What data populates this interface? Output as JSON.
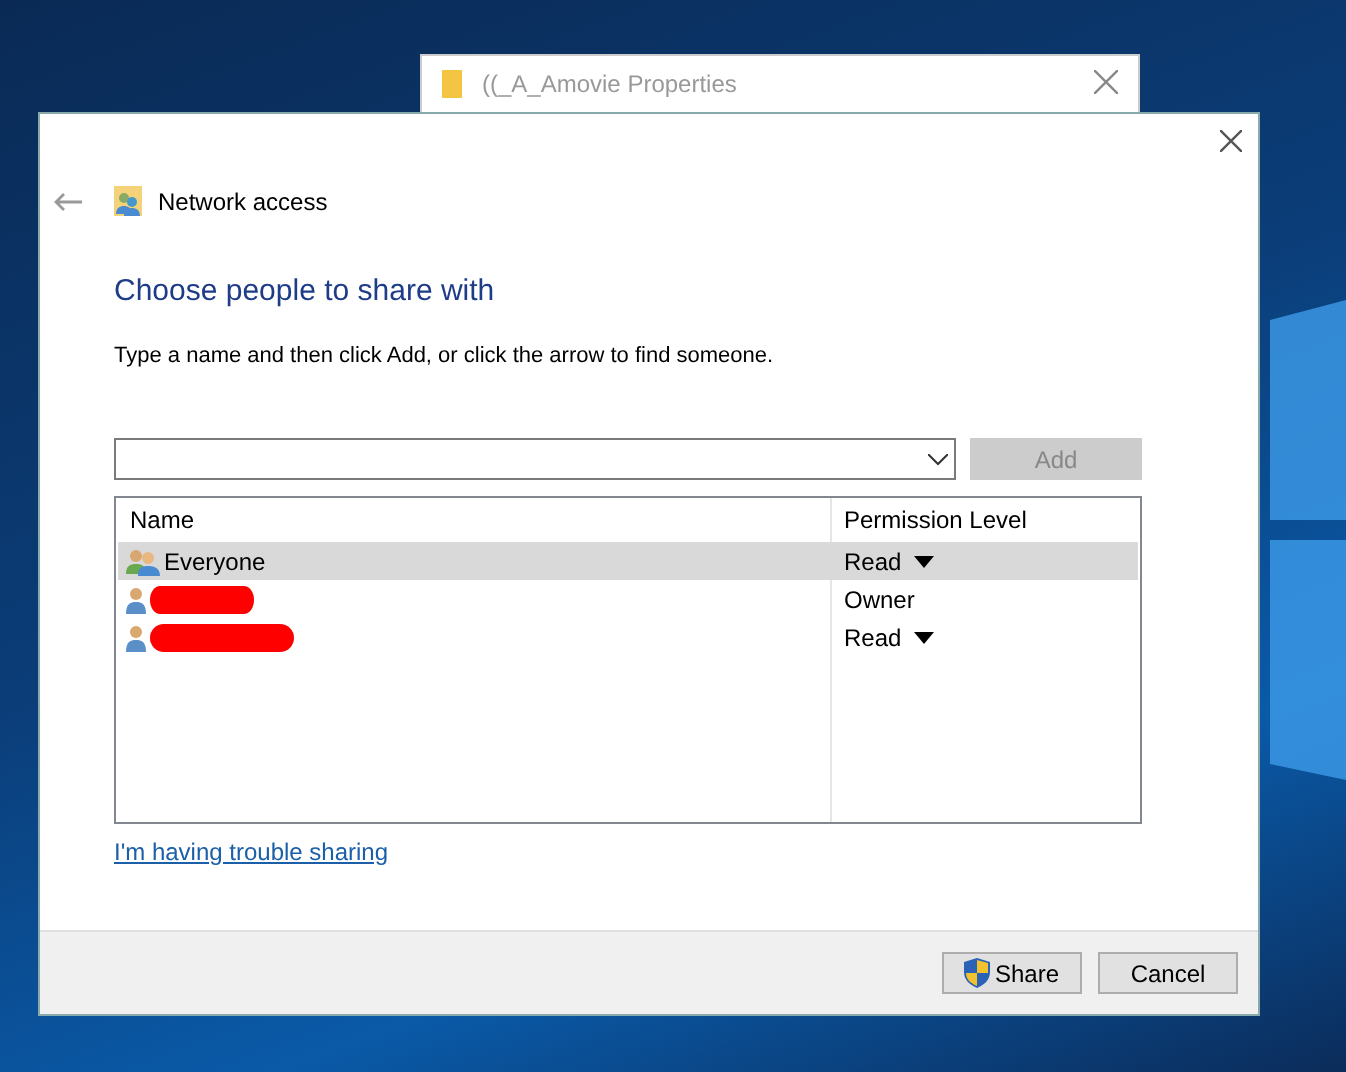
{
  "back_window": {
    "title": "((_A_Amovie Properties"
  },
  "dialog": {
    "title": "Network access",
    "heading": "Choose people to share with",
    "instruction": "Type a name and then click Add, or click the arrow to find someone.",
    "add_button": {
      "label": "Add",
      "disabled": true
    },
    "table": {
      "columns": [
        "Name",
        "Permission Level"
      ],
      "rows": [
        {
          "kind": "group",
          "name": "Everyone",
          "redacted": false,
          "permission": "Read",
          "has_dropdown": true,
          "selected": true
        },
        {
          "kind": "user",
          "redacted": true,
          "permission": "Owner",
          "has_dropdown": false,
          "selected": false
        },
        {
          "kind": "user",
          "redacted": true,
          "permission": "Read",
          "has_dropdown": true,
          "selected": false
        }
      ]
    },
    "help_link": "I'm having trouble sharing",
    "buttons": [
      {
        "label": "Share",
        "kind": "shield"
      },
      {
        "label": "Cancel",
        "kind": "plain"
      }
    ]
  }
}
